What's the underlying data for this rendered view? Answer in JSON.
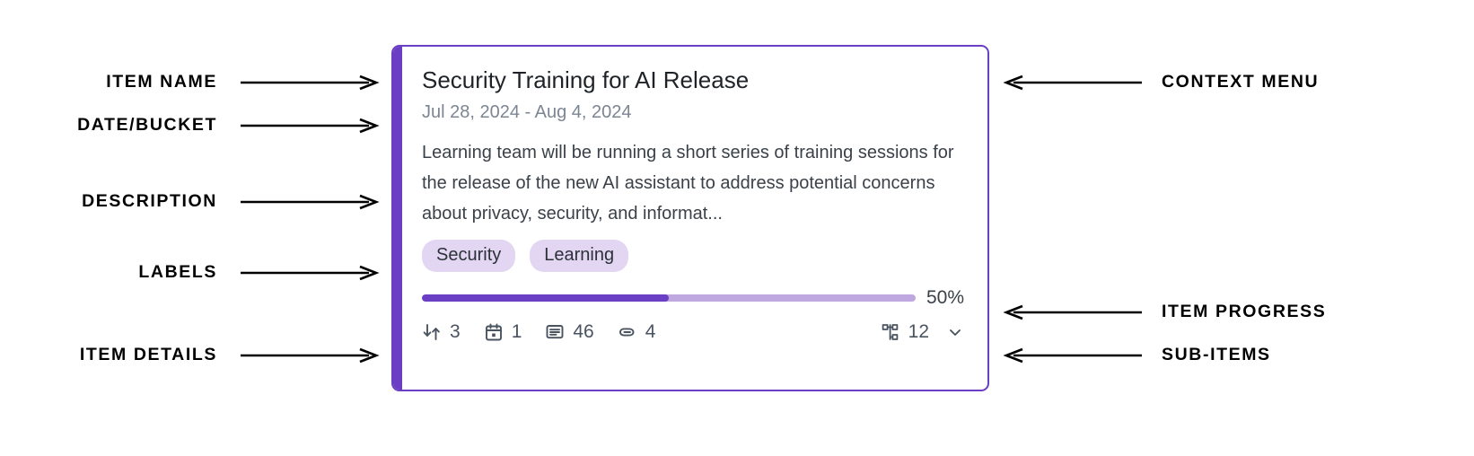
{
  "annotations": {
    "left": [
      {
        "label": "ITEM NAME"
      },
      {
        "label": "DATE/BUCKET"
      },
      {
        "label": "DESCRIPTION"
      },
      {
        "label": "LABELS"
      },
      {
        "label": "ITEM DETAILS"
      }
    ],
    "right": [
      {
        "label": "CONTEXT MENU"
      },
      {
        "label": "ITEM PROGRESS"
      },
      {
        "label": "SUB-ITEMS"
      }
    ]
  },
  "card": {
    "title": "Security Training for AI Release",
    "date_range": "Jul 28, 2024 - Aug 4, 2024",
    "description": "Learning team will be running a short series of training sessions for the release of the new AI assistant to address potential concerns about privacy, security, and informat...",
    "labels": [
      {
        "text": "Security"
      },
      {
        "text": "Learning"
      }
    ],
    "progress": {
      "percent_text": "50%",
      "percent_value": 50
    },
    "details": [
      {
        "icon": "dependency-icon",
        "value": "3"
      },
      {
        "icon": "calendar-icon",
        "value": "1"
      },
      {
        "icon": "comment-icon",
        "value": "46"
      },
      {
        "icon": "attachment-icon",
        "value": "4"
      }
    ],
    "subitems": {
      "icon": "hierarchy-icon",
      "value": "12",
      "chevron": "chevron-down-icon"
    }
  },
  "colors": {
    "accent": "#6B3FC4",
    "progress_track": "#BFA8E0",
    "label_pill_bg": "#E2D6F2",
    "card_border": "#6B3FC4",
    "date_text": "#7C8593",
    "body_text": "#3A4149"
  }
}
